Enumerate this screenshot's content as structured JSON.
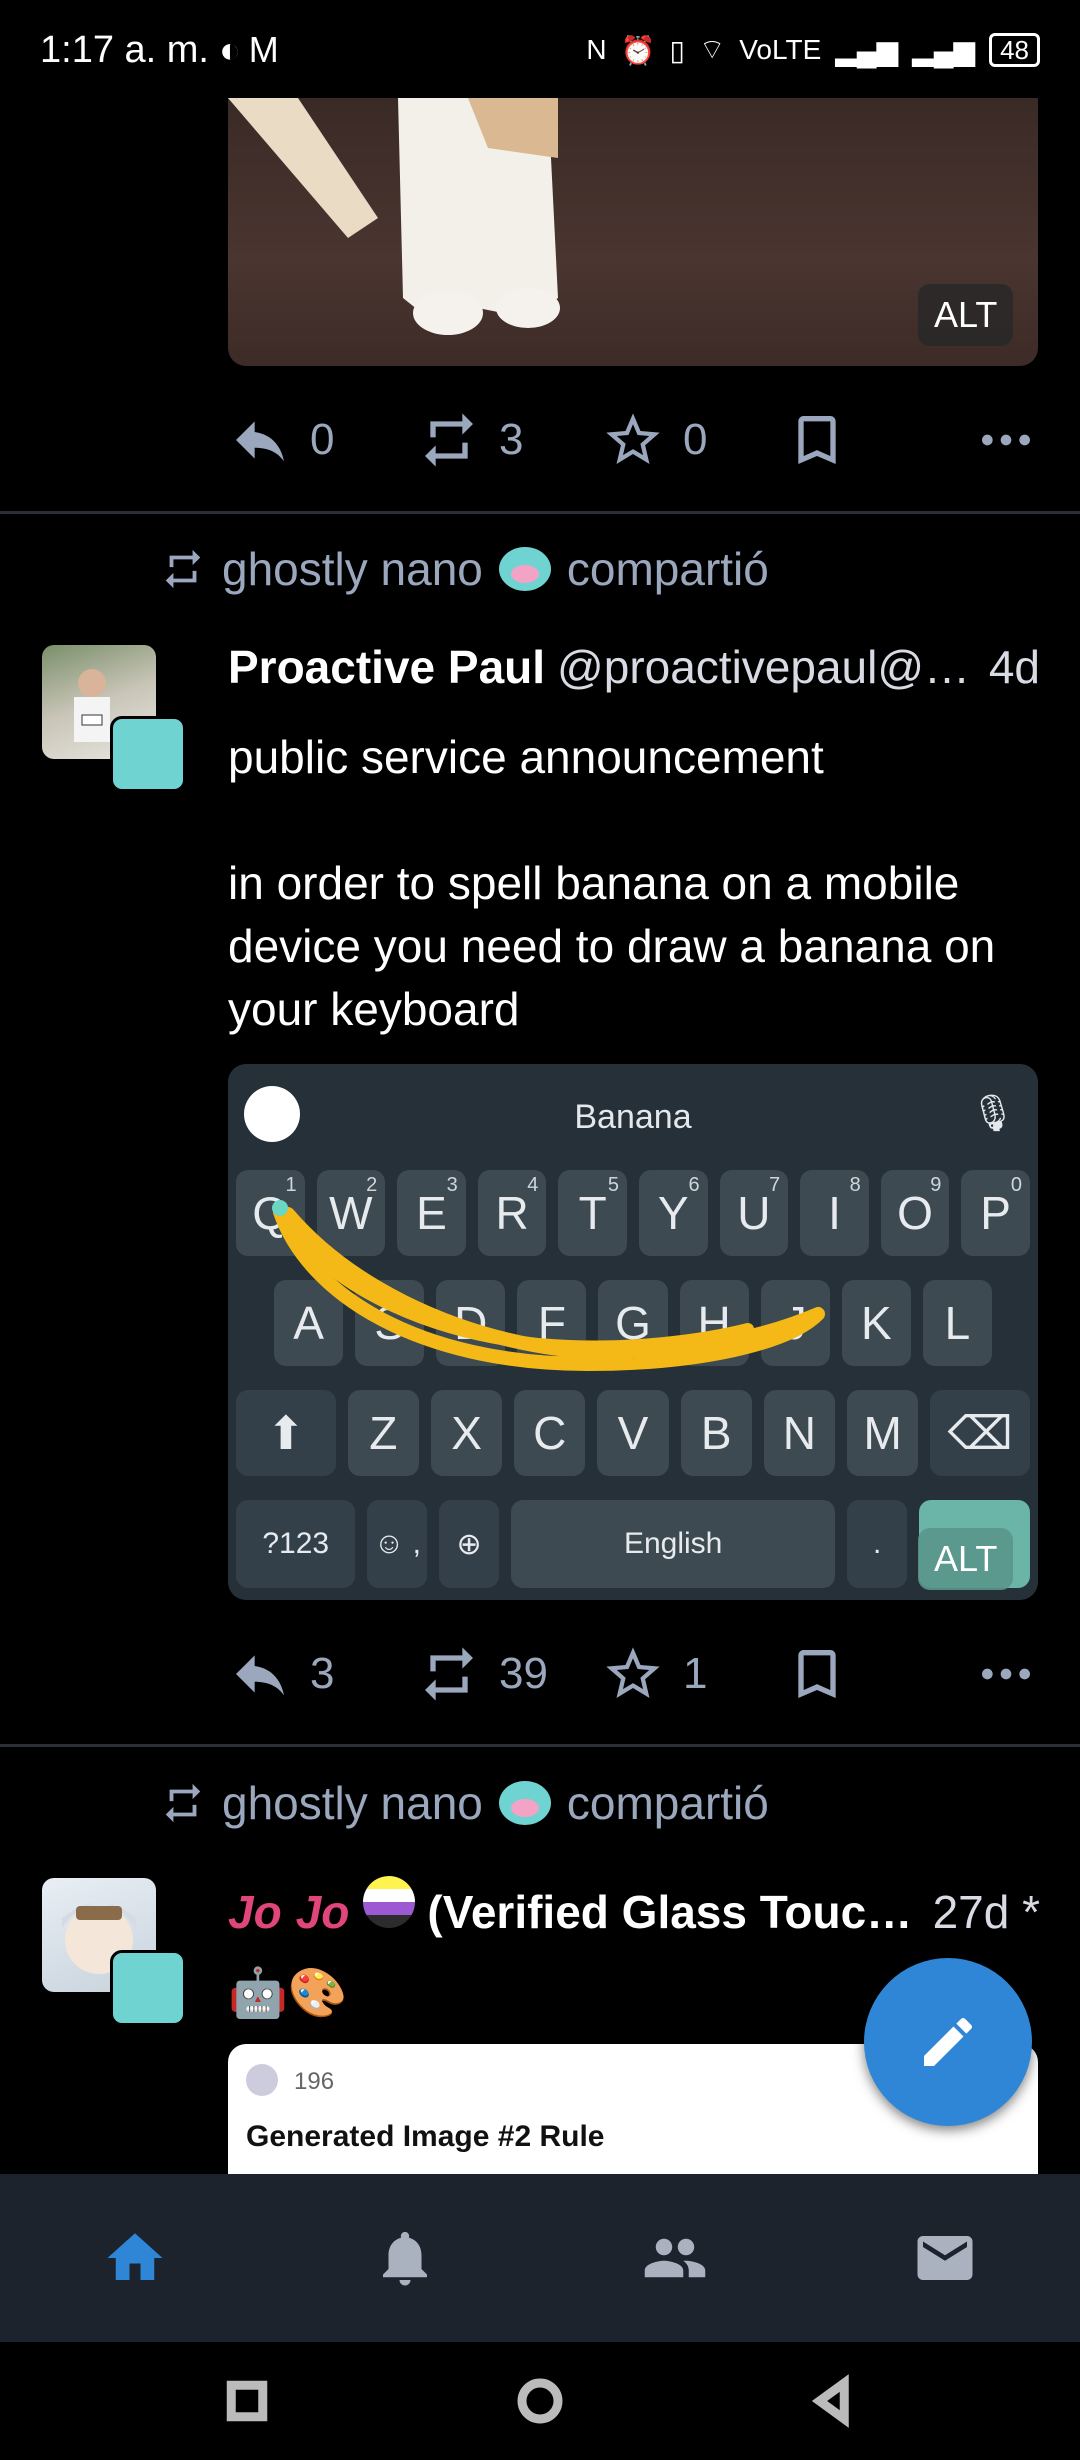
{
  "status_bar": {
    "time": "1:17 a. m.",
    "network": "VoLTE",
    "battery": "48"
  },
  "post1": {
    "alt_label": "ALT",
    "replies": "0",
    "boosts": "3",
    "favourites": "0"
  },
  "post2": {
    "boost_by": "ghostly nano",
    "boost_suffix": "compartió",
    "display_name": "Proactive Paul",
    "acct": "@proactivepaul@…",
    "time": "4d",
    "text_line1": "public service announcement",
    "text_line2": "in order to spell banana on a mobile device you need to draw a banana on your keyboard",
    "alt_label": "ALT",
    "replies": "3",
    "boosts": "39",
    "favourites": "1",
    "keyboard": {
      "suggestion": "Banana",
      "row1": [
        "Q",
        "W",
        "E",
        "R",
        "T",
        "Y",
        "U",
        "I",
        "O",
        "P"
      ],
      "row1_nums": [
        "1",
        "2",
        "3",
        "4",
        "5",
        "6",
        "7",
        "8",
        "9",
        "0"
      ],
      "row2": [
        "A",
        "S",
        "D",
        "F",
        "G",
        "H",
        "J",
        "K",
        "L"
      ],
      "row3": [
        "Z",
        "X",
        "C",
        "V",
        "B",
        "N",
        "M"
      ],
      "sym_key": "?123",
      "emoji_key": "☺ ,",
      "space_label": "English",
      "period_key": "."
    }
  },
  "post3": {
    "boost_by": "ghostly nano",
    "boost_suffix": "compartió",
    "display_name": "(Verified Glass Touc…",
    "time": "27d *",
    "emojis": "🤖🎨",
    "card_count": "196",
    "card_title": "Generated Image #2 Rule"
  },
  "nav": {
    "items": [
      "home-icon",
      "bell-icon",
      "people-icon",
      "mail-icon"
    ],
    "accent": "#2f86d6"
  }
}
